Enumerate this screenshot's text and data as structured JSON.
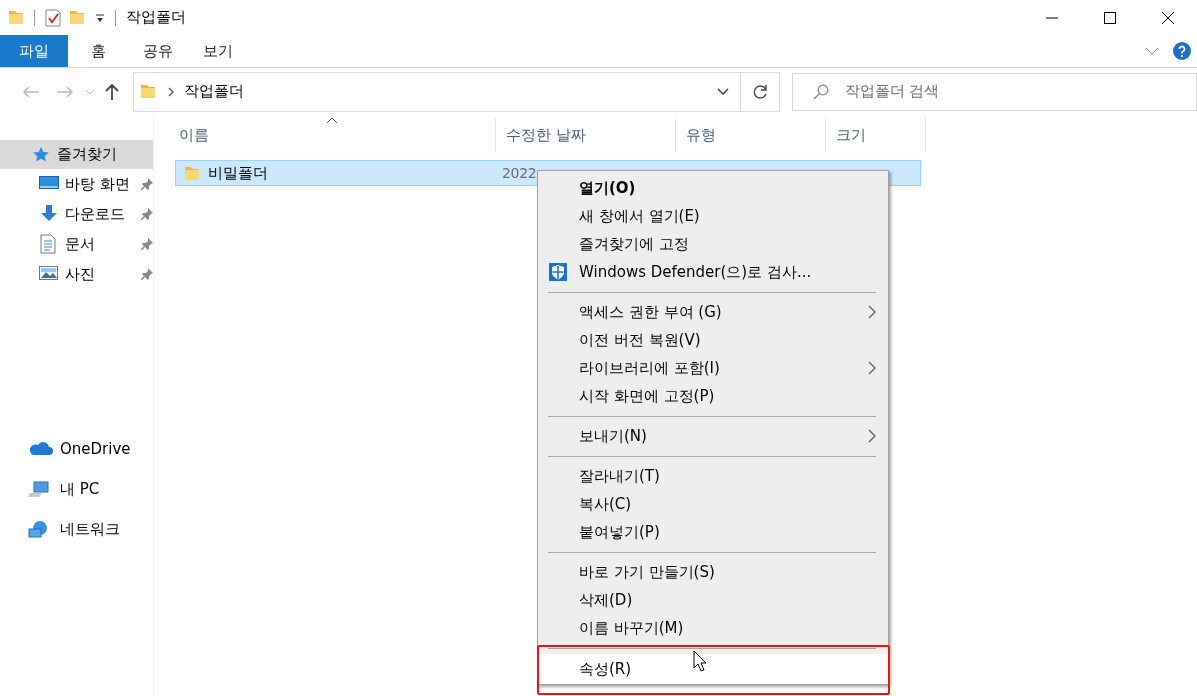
{
  "window": {
    "title": "작업폴더"
  },
  "ribbon_tabs": [
    {
      "label": "파일",
      "kind": "file"
    },
    {
      "label": "홈",
      "kind": "tab"
    },
    {
      "label": "공유",
      "kind": "tab"
    },
    {
      "label": "보기",
      "kind": "tab"
    }
  ],
  "address_bar": {
    "path": "작업폴더"
  },
  "search": {
    "placeholder": "작업폴더 검색"
  },
  "sidebar": {
    "items": [
      {
        "label": "즐겨찾기",
        "selected": true,
        "children": [
          {
            "label": "바탕 화면",
            "pinned": true
          },
          {
            "label": "다운로드",
            "pinned": true
          },
          {
            "label": "문서",
            "pinned": true
          },
          {
            "label": "사진",
            "pinned": true
          }
        ]
      },
      {
        "label": "OneDrive",
        "selected": false
      },
      {
        "label": "내 PC",
        "selected": false
      },
      {
        "label": "네트워크",
        "selected": false
      }
    ]
  },
  "file_list": {
    "columns": [
      {
        "label": "이름",
        "sorted": true
      },
      {
        "label": "수정한 날짜",
        "sorted": false
      },
      {
        "label": "유형",
        "sorted": false
      },
      {
        "label": "크기",
        "sorted": false
      }
    ],
    "rows": [
      {
        "name": "비밀폴더",
        "date": "2022",
        "selected": true
      }
    ]
  },
  "context_menu": {
    "groups": [
      {
        "items": [
          {
            "label": "열기(O)",
            "kind": "default",
            "highlighted": false
          },
          {
            "label": "새 창에서 열기(E)",
            "kind": "plain",
            "highlighted": false
          },
          {
            "label": "즐겨찾기에 고정",
            "kind": "plain",
            "highlighted": false
          },
          {
            "label": "Windows Defender(으)로 검사...",
            "kind": "shield",
            "highlighted": false
          }
        ]
      },
      {
        "items": [
          {
            "label": "액세스 권한 부여 (G)",
            "kind": "submenu",
            "highlighted": false
          },
          {
            "label": "이전 버전 복원(V)",
            "kind": "plain",
            "highlighted": false
          },
          {
            "label": "라이브러리에 포함(I)",
            "kind": "submenu",
            "highlighted": false
          },
          {
            "label": "시작 화면에 고정(P)",
            "kind": "plain",
            "highlighted": false
          }
        ]
      },
      {
        "items": [
          {
            "label": "보내기(N)",
            "kind": "submenu",
            "highlighted": false
          }
        ]
      },
      {
        "items": [
          {
            "label": "잘라내기(T)",
            "kind": "plain",
            "highlighted": false
          },
          {
            "label": "복사(C)",
            "kind": "plain",
            "highlighted": false
          },
          {
            "label": "붙여넣기(P)",
            "kind": "plain",
            "highlighted": false
          }
        ]
      },
      {
        "items": [
          {
            "label": "바로 가기 만들기(S)",
            "kind": "plain",
            "highlighted": false
          },
          {
            "label": "삭제(D)",
            "kind": "plain",
            "highlighted": false
          },
          {
            "label": "이름 바꾸기(M)",
            "kind": "plain",
            "highlighted": false
          }
        ]
      },
      {
        "items": [
          {
            "label": "속성(R)",
            "kind": "plain",
            "highlighted": true
          }
        ]
      }
    ]
  }
}
